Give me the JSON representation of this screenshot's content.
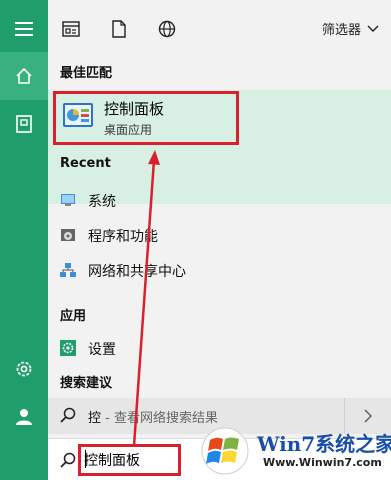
{
  "toolbar": {
    "filter_label": "筛选器"
  },
  "results": {
    "best_match_heading": "最佳匹配",
    "best_match": {
      "title": "控制面板",
      "subtitle": "桌面应用"
    },
    "recent_heading": "Recent",
    "recent_items": [
      {
        "label": "系统",
        "icon": "system-monitor-icon"
      },
      {
        "label": "程序和功能",
        "icon": "programs-features-icon"
      },
      {
        "label": "网络和共享中心",
        "icon": "network-sharing-icon"
      }
    ],
    "apps_heading": "应用",
    "apps": [
      {
        "label": "设置",
        "icon": "settings-gear-icon"
      }
    ],
    "suggestions_heading": "搜索建议",
    "suggestion": {
      "query": "控",
      "suffix": " - 查看网络搜索结果"
    }
  },
  "search": {
    "value": "控制面板"
  },
  "watermark": {
    "brand": "Win7系统之家",
    "url": "Www.Winwin7.com"
  },
  "colors": {
    "rail": "#1f9e6b",
    "rail_active": "#39b17f",
    "best_match_bg": "#d8f0e3",
    "annotation": "#d8212c"
  }
}
